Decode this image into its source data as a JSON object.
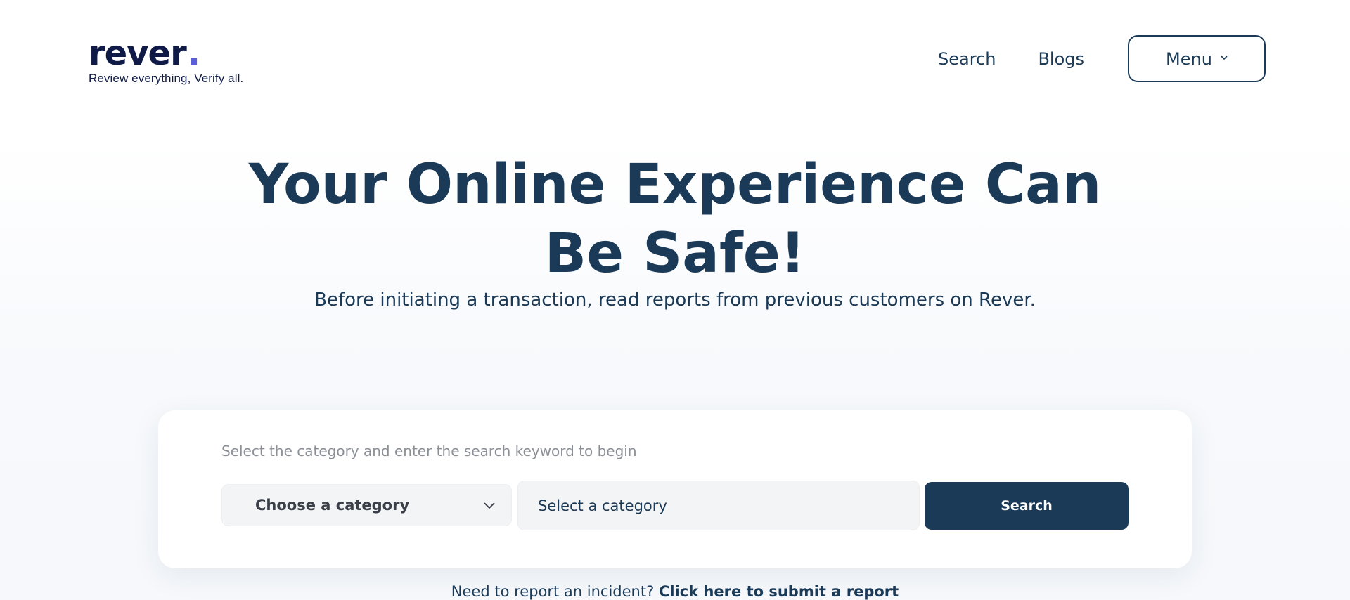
{
  "brand": {
    "name": "rever",
    "dot": ".",
    "tagline": "Review everything, Verify all.",
    "dot_color": "#5a5ed8"
  },
  "nav": {
    "search_label": "Search",
    "blogs_label": "Blogs",
    "menu_label": "Menu",
    "menu_icon": "chevron-down-icon"
  },
  "hero": {
    "title_line1": "Your Online Experience Can",
    "title_line2": "Be Safe!",
    "subtitle": "Before initiating a transaction, read reports from previous customers on Rever."
  },
  "search_card": {
    "hint": "Select the category and enter the search keyword to begin",
    "category_selected": "Choose a category",
    "category_icon": "chevron-down-icon",
    "keyword_placeholder": "Select a category",
    "search_button": "Search"
  },
  "report": {
    "prompt": "Need to report an incident?",
    "link_text": "Click here to submit a report"
  },
  "colors": {
    "primary": "#1b3a57",
    "brand_text": "#0f1a47",
    "input_bg": "#f3f4f6",
    "hint_text": "#8b8f96"
  }
}
